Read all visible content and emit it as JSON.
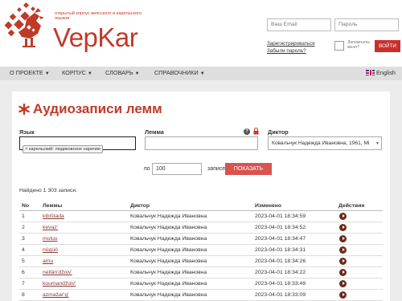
{
  "header": {
    "tagline": "открытый корпус вепсского и карельского языков",
    "brand": "VepKar",
    "email_placeholder": "Ваш Email",
    "password_placeholder": "Пароль",
    "register_link": "Зарегистрироваться",
    "forgot_link": "Забыли пароль?",
    "remember_label": "Запомнить меня?",
    "login_button": "ВОЙТИ"
  },
  "nav": {
    "items": [
      {
        "label": "О ПРОЕКТЕ",
        "caret": "▼"
      },
      {
        "label": "КОРПУС",
        "caret": "▼"
      },
      {
        "label": "СЛОВАРЬ",
        "caret": "▼"
      },
      {
        "label": "СПРАВОЧНИКИ",
        "caret": "▼"
      }
    ],
    "language": "English"
  },
  "page": {
    "title": "Аудиозаписи лемм",
    "filters": {
      "language_label": "Язык",
      "language_chip": "× карельский: людиковское наречие",
      "lemma_label": "Лемма",
      "help_symbol": "?",
      "dictor_label": "Диктор",
      "dictor_value": "Ковальчук Надежда Ивановна, 1961, Мі",
      "per_page_prefix": "по",
      "per_page_value": "100",
      "per_page_suffix": "записей",
      "show_button": "ПОКАЗАТЬ"
    },
    "found_text": "Найдено 1 303 записи."
  },
  "table": {
    "headers": [
      "No",
      "Леммы",
      "Диктор",
      "Изменено",
      "Действия"
    ],
    "rows": [
      {
        "no": "1",
        "lemma": "kibištada",
        "dictor": "Ковальчук Надежда Ивановна",
        "changed": "2023-04-01 18:34:59"
      },
      {
        "no": "2",
        "lemma": "kevaz'",
        "dictor": "Ковальчук Надежда Ивановна",
        "changed": "2023-04-01 18:34:52"
      },
      {
        "no": "3",
        "lemma": "muluu",
        "dictor": "Ковальчук Надежда Ивановна",
        "changed": "2023-04-01 18:34:47"
      },
      {
        "no": "4",
        "lemma": "nügüö",
        "dictor": "Ковальчук Надежда Ивановна",
        "changed": "2023-04-01 18:34:31"
      },
      {
        "no": "5",
        "lemma": "amu",
        "dictor": "Ковальчук Надежда Ивановна",
        "changed": "2023-04-01 18:34:26"
      },
      {
        "no": "6",
        "lemma": "nellän'džoiv'",
        "dictor": "Ковальчук Надежда Ивановна",
        "changed": "2023-04-01 18:34:22"
      },
      {
        "no": "7",
        "lemma": "koumandžoiv'",
        "dictor": "Ковальчук Надежда Ивановна",
        "changed": "2023-04-01 18:33:49"
      },
      {
        "no": "8",
        "lemma": "azmažar'g'",
        "dictor": "Ковальчук Надежда Ивановна",
        "changed": "2023-04-01 18:33:09"
      }
    ]
  },
  "colors": {
    "brand_red": "#c03a28",
    "button_red": "#d9534f",
    "play_button": "#6b2a1a"
  }
}
